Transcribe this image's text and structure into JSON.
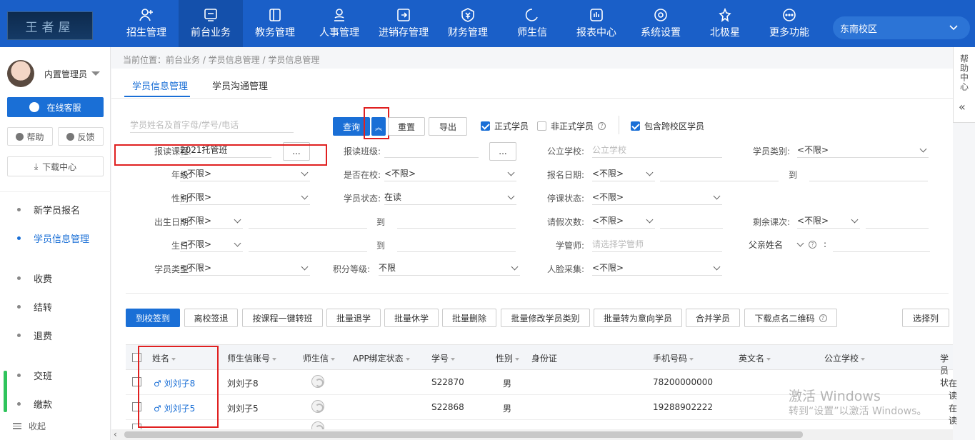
{
  "header": {
    "logo_text": "王者屋",
    "nav": [
      {
        "label": "招生管理",
        "icon": "add-user-icon"
      },
      {
        "label": "前台业务",
        "icon": "monitor-icon",
        "active": true
      },
      {
        "label": "教务管理",
        "icon": "book-icon"
      },
      {
        "label": "人事管理",
        "icon": "person-icon"
      },
      {
        "label": "进销存管理",
        "icon": "inventory-icon"
      },
      {
        "label": "财务管理",
        "icon": "yuan-icon"
      },
      {
        "label": "师生信",
        "icon": "chat-icon"
      },
      {
        "label": "报表中心",
        "icon": "report-icon"
      },
      {
        "label": "系统设置",
        "icon": "gear-icon"
      },
      {
        "label": "北极星",
        "icon": "star-icon"
      },
      {
        "label": "更多功能",
        "icon": "more-icon"
      }
    ],
    "campus": "东南校区"
  },
  "sidebar": {
    "user_name": "内置管理员",
    "online_service": "在线客服",
    "help": "帮助",
    "feedback": "反馈",
    "download_center": "下载中心",
    "menu": [
      "新学员报名",
      "学员信息管理",
      "收费",
      "结转",
      "退费",
      "交班",
      "缴款"
    ],
    "collapse": "收起"
  },
  "help_tab": "帮助中心",
  "breadcrumb": "当前位置：前台业务 / 学员信息管理 / 学员信息管理",
  "tabs": [
    "学员信息管理",
    "学员沟通管理"
  ],
  "search": {
    "placeholder": "学员姓名及首字母/学号/电话",
    "query": "查询",
    "reset": "重置",
    "export": "导出",
    "formal": "正式学员",
    "informal": "非正式学员",
    "cross_campus": "包含跨校区学员"
  },
  "filters": {
    "course_label": "报读课程:",
    "course_value": "2021托管班",
    "class_label": "报读班级:",
    "school_label": "公立学校:",
    "school_ph": "公立学校",
    "type_label": "学员类别:",
    "type_value": "<不限>",
    "grade_label": "年级:",
    "grade_value": "<不限>",
    "inschool_label": "是否在校:",
    "inschool_value": "<不限>",
    "regdate_label": "报名日期:",
    "regdate_value": "<不限>",
    "to": "到",
    "gender_label": "性别:",
    "gender_value": "<不限>",
    "status_label": "学员状态:",
    "status_value": "在读",
    "suspend_label": "停课状态:",
    "suspend_value": "<不限>",
    "birth_label": "出生日期:",
    "birth_value": "<不限>",
    "leave_label": "请假次数:",
    "leave_value": "<不限>",
    "remain_label": "剩余课次:",
    "remain_value": "<不限>",
    "bday_label": "生日:",
    "bday_value": "<不限>",
    "tutor_label": "学管师:",
    "tutor_ph": "请选择学管师",
    "father_label": "父亲姓名",
    "stype_label": "学员类型:",
    "stype_value": "<不限>",
    "points_label": "积分等级:",
    "points_value": "不限",
    "face_label": "人脸采集:",
    "face_value": "<不限>",
    "ellipsis": "..."
  },
  "actions": [
    "到校签到",
    "离校签退",
    "按课程一键转班",
    "批量退学",
    "批量休学",
    "批量删除",
    "批量修改学员类别",
    "批量转为意向学员",
    "合并学员",
    "下载点名二维码"
  ],
  "select_columns": "选择列",
  "table": {
    "headers": [
      "姓名",
      "师生信账号",
      "师生信",
      "APP绑定状态",
      "学号",
      "性别",
      "身份证",
      "手机号码",
      "英文名",
      "公立学校",
      "学员状"
    ],
    "rows": [
      {
        "name": "♂ 刘刘子8",
        "account": "刘刘子8",
        "id": "S22870",
        "gender": "男",
        "phone": "78200000000",
        "status": "在读"
      },
      {
        "name": "♂ 刘刘子5",
        "account": "刘刘子5",
        "id": "S22868",
        "gender": "男",
        "phone": "19288902222",
        "status": "在读"
      }
    ]
  },
  "watermark": {
    "line1": "激活 Windows",
    "line2": "转到“设置”以激活 Windows。"
  }
}
